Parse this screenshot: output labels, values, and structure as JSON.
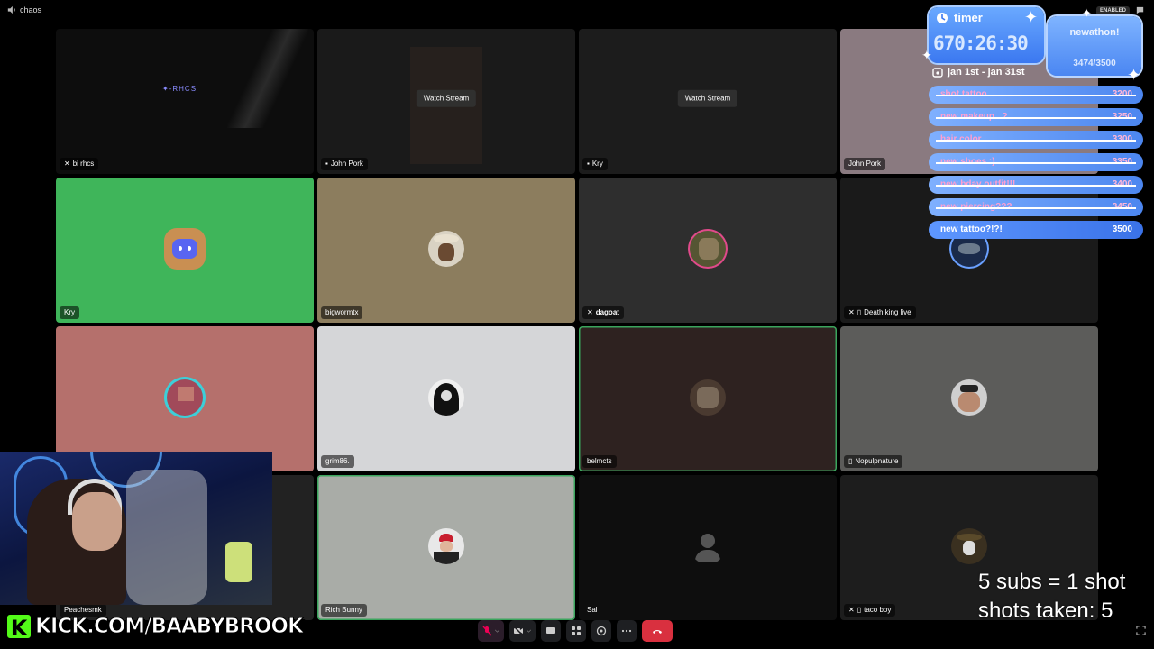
{
  "channel_name": "chaos",
  "enabled_badge": "ENABLED",
  "tiles": [
    {
      "name": "bi rhcs",
      "bg": "#0d0d0d",
      "watch": "",
      "logo_text": "✦-RHCS"
    },
    {
      "name": "John Pork",
      "bg": "#1a1a1a",
      "watch": "Watch Stream"
    },
    {
      "name": "Kry",
      "bg": "#1c1c1c",
      "watch": "Watch Stream"
    },
    {
      "name": "John Pork",
      "bg": "#8a7a80"
    },
    {
      "name": "Kry",
      "bg": "#3fb55a"
    },
    {
      "name": "bigwormtx",
      "bg": "#8c7d5e"
    },
    {
      "name": "dagoat",
      "bg": "#2e2e2e"
    },
    {
      "name": "Death king live",
      "bg": "#1a1a1a"
    },
    {
      "name": "",
      "bg": "#b5706c"
    },
    {
      "name": "grim86.",
      "bg": "#d5d6d8"
    },
    {
      "name": "belmcts",
      "bg": "#2e2220"
    },
    {
      "name": "Nopulpnature",
      "bg": "#5c5c5a"
    },
    {
      "name": "Peachesmk",
      "bg": "#222"
    },
    {
      "name": "Rich Bunny",
      "bg": "#a9aca7"
    },
    {
      "name": "Sal",
      "bg": "#0e0e0e"
    },
    {
      "name": "taco boy",
      "bg": "#1d1d1d"
    }
  ],
  "overlay": {
    "timer_title": "timer",
    "timer_value": "670:26:30",
    "newathon_title": "newathon!",
    "newathon_count": "3474/3500",
    "date_range": "jan 1st - jan 31st",
    "goals": [
      {
        "label": "shot tattoo",
        "value": "3200",
        "done": true
      },
      {
        "label": "new makeup...?",
        "value": "3250",
        "done": true
      },
      {
        "label": "hair color",
        "value": "3300",
        "done": true
      },
      {
        "label": "new shoes :)",
        "value": "3350",
        "done": true
      },
      {
        "label": "new bday outfit!!!",
        "value": "3400",
        "done": true
      },
      {
        "label": "new piercing???",
        "value": "3450",
        "done": true
      },
      {
        "label": "new tattoo?!?!",
        "value": "3500",
        "done": false
      }
    ]
  },
  "subs_line1": "5 subs = 1 shot",
  "subs_line2": "shots taken: 5",
  "kick_letter": "K",
  "kick_url": "KICK.COM/BAABYBROOK",
  "accent_color": "#3b78f0",
  "hangup_color": "#d9303f"
}
